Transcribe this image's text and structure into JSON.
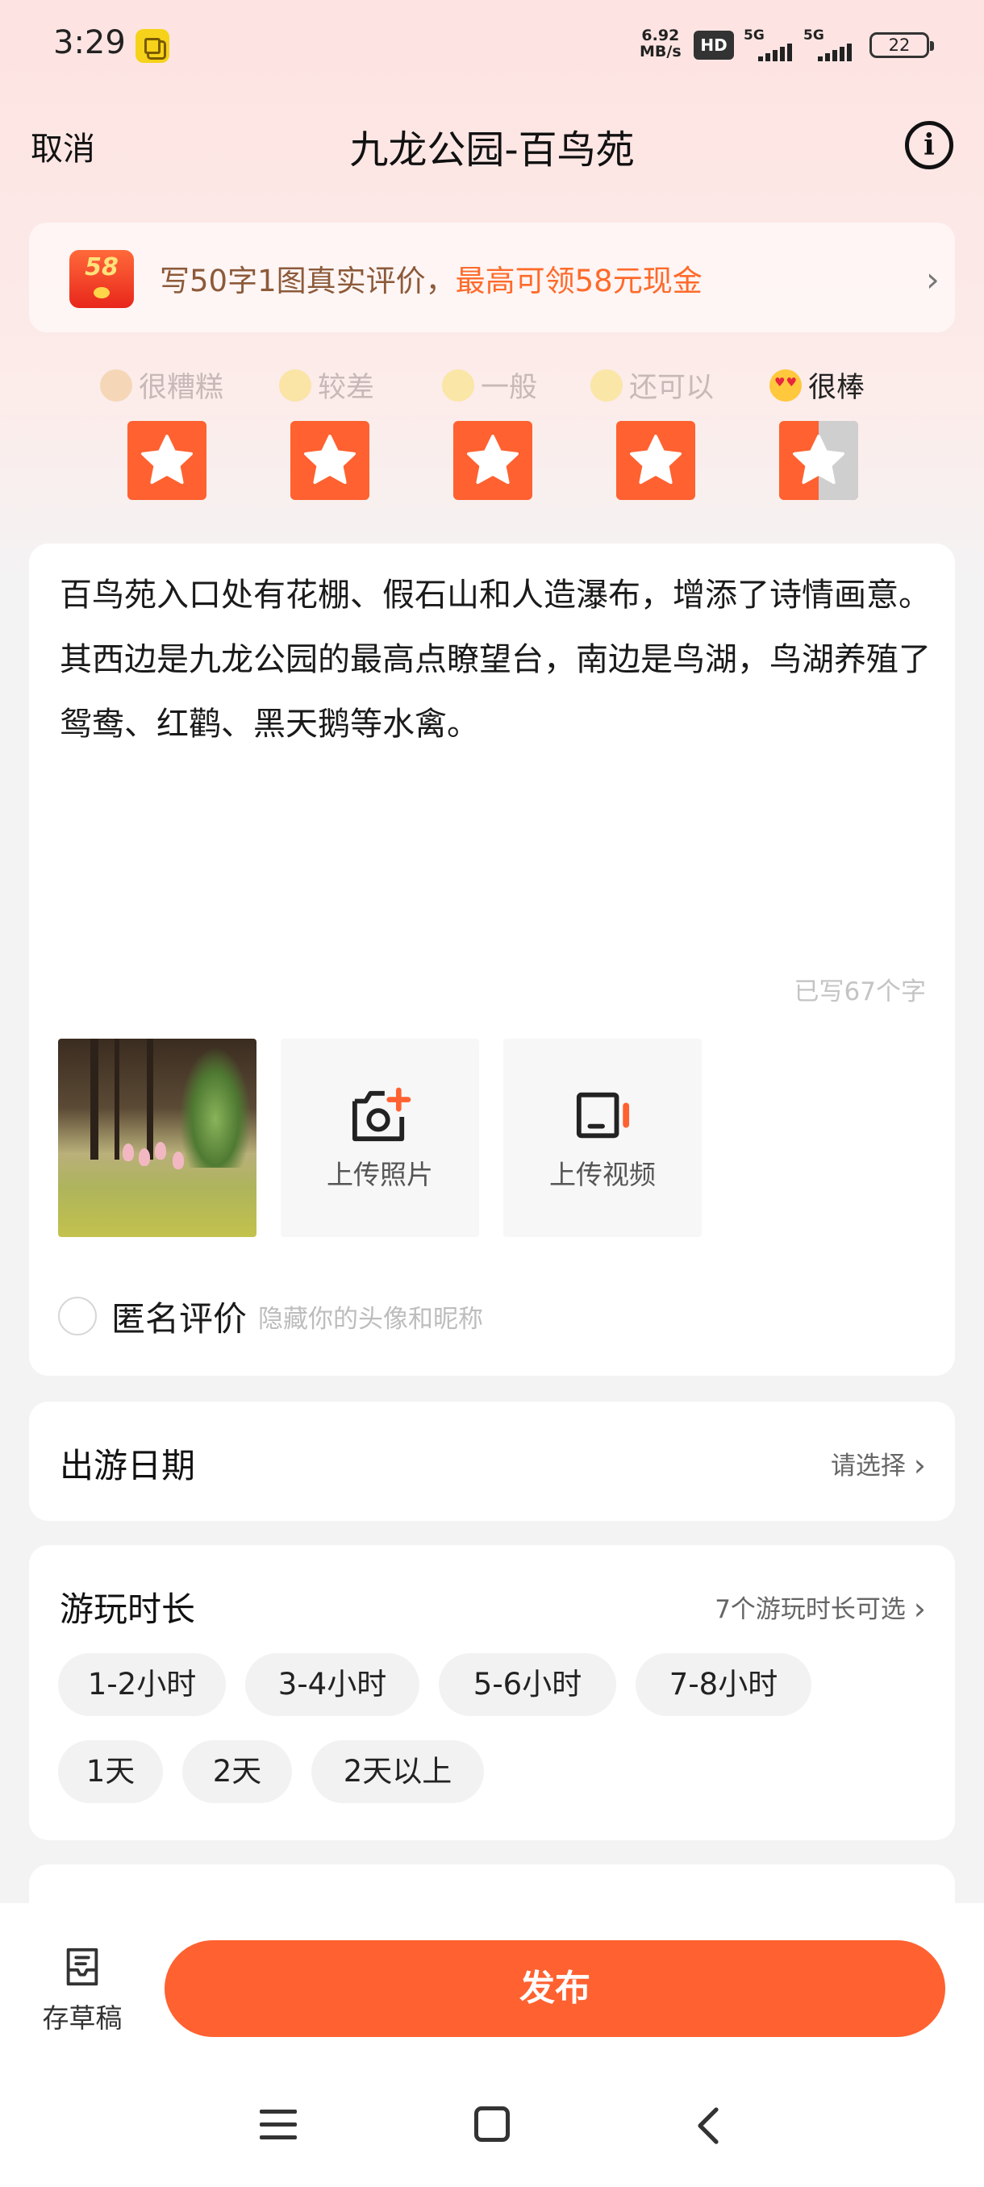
{
  "status_bar": {
    "time": "3:29",
    "net_speed_value": "6.92",
    "net_speed_unit": "MB/s",
    "hd_label": "HD",
    "signal1_label": "5G",
    "signal2_label": "5G",
    "battery": "22"
  },
  "header": {
    "cancel": "取消",
    "title": "九龙公园-百鸟苑",
    "info_icon": "i"
  },
  "promo": {
    "badge": "58",
    "text_plain": "写50字1图真实评价，",
    "text_highlight": "最高可领58元现金",
    "arrow": "›"
  },
  "rating": {
    "labels": [
      "很糟糕",
      "较差",
      "一般",
      "还可以",
      "很棒"
    ],
    "selected_index": 4,
    "value": 4.5,
    "max": 5,
    "colors": {
      "active": "#ff6130",
      "inactive": "#cfcfcf"
    }
  },
  "review": {
    "text": "百鸟苑入口处有花棚、假石山和人造瀑布，增添了诗情画意。其西边是九龙公园的最高点瞭望台，南边是鸟湖，鸟湖养殖了鸳鸯、红鹳、黑天鹅等水禽。",
    "word_count": "已写67个字"
  },
  "media": {
    "upload_photo": "上传照片",
    "upload_video": "上传视频",
    "photo_icon": "camera-plus-icon",
    "video_icon": "video-camera-icon"
  },
  "anonymous": {
    "label": "匿名评价",
    "hint": "隐藏你的头像和昵称"
  },
  "travel_date": {
    "title": "出游日期",
    "action": "请选择"
  },
  "duration": {
    "title": "游玩时长",
    "action": "7个游玩时长可选",
    "options": [
      "1-2小时",
      "3-4小时",
      "5-6小时",
      "7-8小时",
      "1天",
      "2天",
      "2天以上"
    ]
  },
  "bottom": {
    "draft": "存草稿",
    "publish": "发布"
  },
  "colors": {
    "accent": "#ff6130",
    "promo_highlight": "#ff6a2a",
    "promo_text": "#8c5a3a"
  }
}
